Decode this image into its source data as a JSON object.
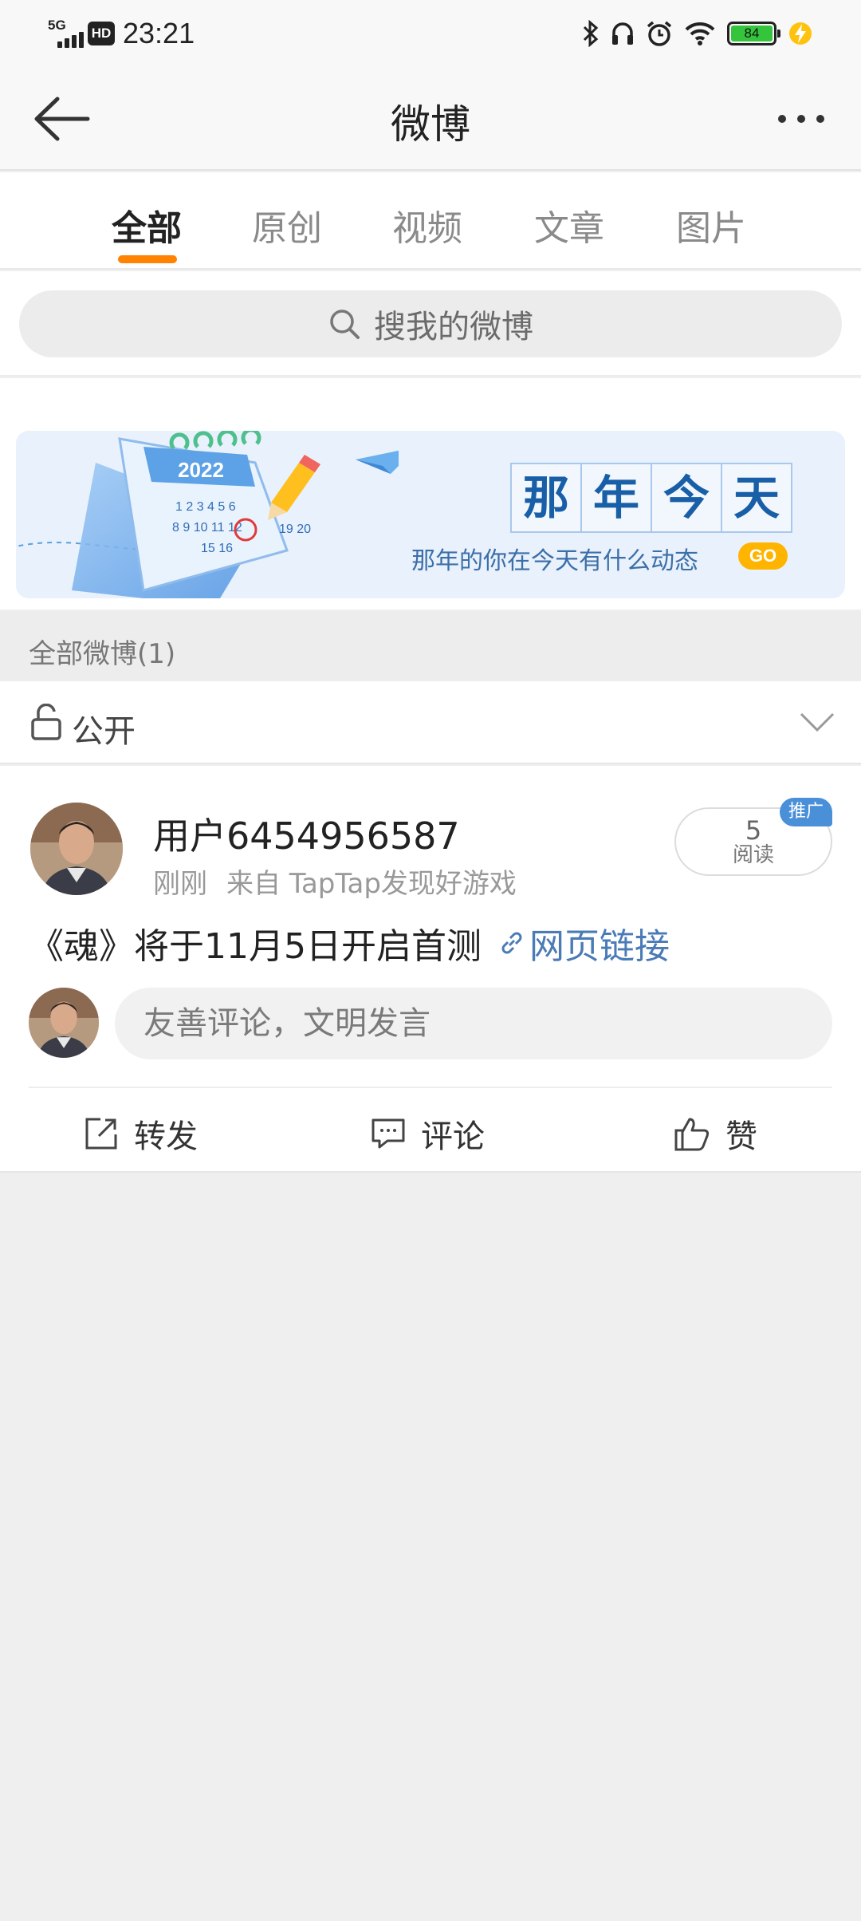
{
  "status_bar": {
    "network": "5G",
    "hd": "HD",
    "time": "23:21",
    "battery": "84",
    "icons": [
      "bluetooth-icon",
      "headphones-icon",
      "alarm-icon",
      "wifi-icon",
      "battery-icon",
      "charging-icon"
    ]
  },
  "header": {
    "title": "微博"
  },
  "tabs": [
    {
      "label": "全部",
      "active": true
    },
    {
      "label": "原创",
      "active": false
    },
    {
      "label": "视频",
      "active": false
    },
    {
      "label": "文章",
      "active": false
    },
    {
      "label": "图片",
      "active": false
    }
  ],
  "search": {
    "placeholder": "搜我的微博"
  },
  "banner": {
    "calendar_year": "2022",
    "title_chars": [
      "那",
      "年",
      "今",
      "天"
    ],
    "subtitle": "那年的你在今天有什么动态",
    "go_label": "GO"
  },
  "section": {
    "title": "全部微博(1)"
  },
  "visibility": {
    "label": "公开"
  },
  "post": {
    "user_name": "用户6454956587",
    "time": "刚刚",
    "source": "来自 TapTap发现好游戏",
    "read_count": "5",
    "read_label": "阅读",
    "promo_label": "推广",
    "text": "《魂》将于11月5日开启首测",
    "link_label": "网页链接",
    "comment_placeholder": "友善评论，文明发言",
    "actions": {
      "repost": "转发",
      "comment": "评论",
      "like": "赞"
    }
  },
  "colors": {
    "accent": "#ff8200",
    "link": "#4a7bb6",
    "promo": "#4a90d9",
    "banner_title": "#185fa8"
  }
}
